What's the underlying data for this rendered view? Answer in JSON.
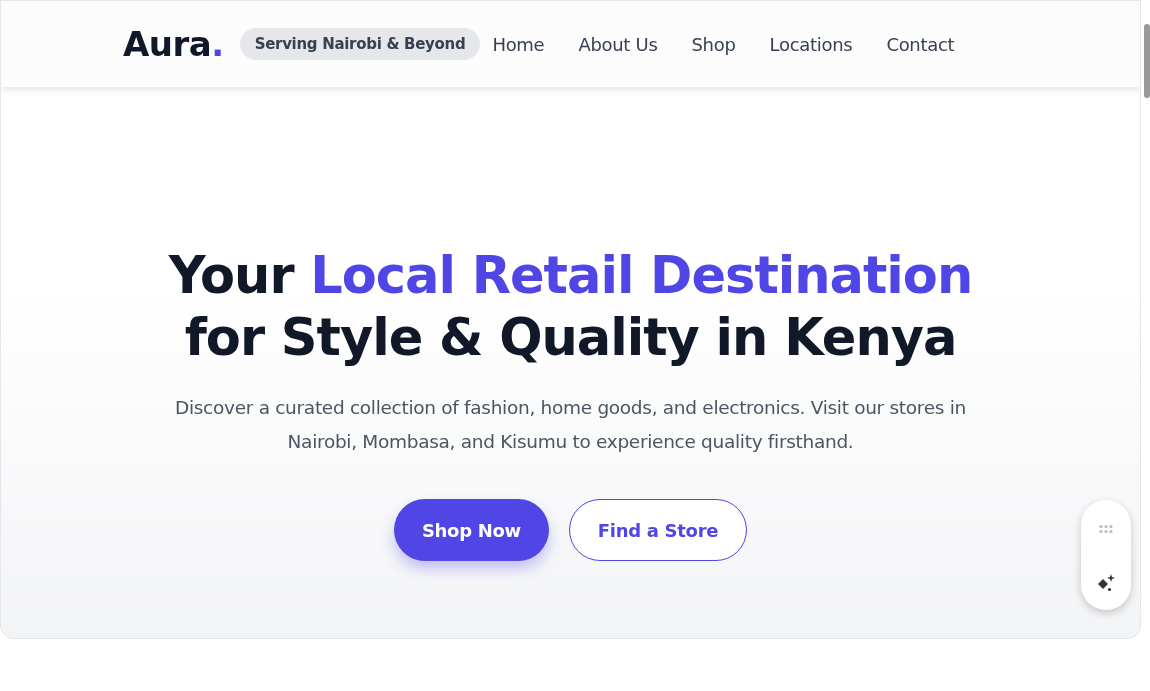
{
  "brand": {
    "name": "Aura",
    "dot": "."
  },
  "badge": "Serving Nairobi & Beyond",
  "nav": [
    {
      "label": "Home"
    },
    {
      "label": "About Us"
    },
    {
      "label": "Shop"
    },
    {
      "label": "Locations"
    },
    {
      "label": "Contact"
    }
  ],
  "hero": {
    "headline": [
      [
        {
          "text": "Your ",
          "accent": false
        },
        {
          "text": "Local Retail Destination",
          "accent": true
        }
      ],
      [
        {
          "text": "for Style & Quality in Kenya",
          "accent": false
        }
      ]
    ],
    "description": "Discover a curated collection of fashion, home goods, and electronics. Visit our stores in Nairobi, Mombasa, and Kisumu to experience quality firsthand.",
    "buttons": [
      {
        "label": "Shop Now",
        "kind": "primary"
      },
      {
        "label": "Find a Store",
        "kind": "outline"
      }
    ]
  }
}
